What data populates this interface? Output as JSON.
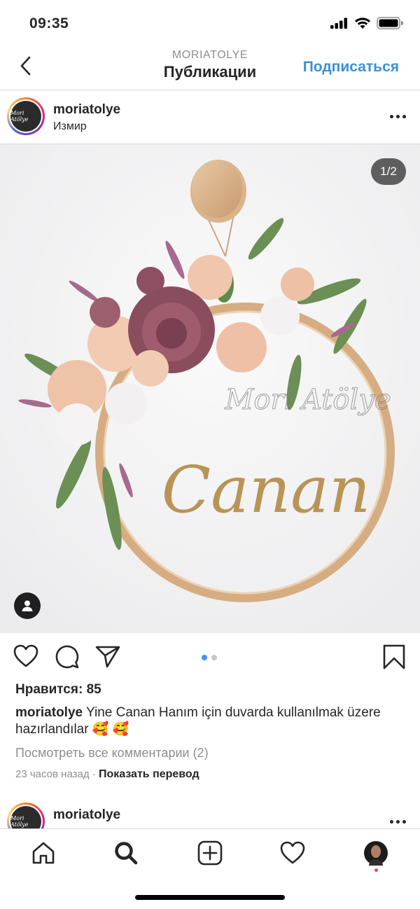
{
  "status_bar": {
    "time": "09:35"
  },
  "nav": {
    "subtitle": "MORIATOLYE",
    "title": "Публикации",
    "follow_label": "Подписаться"
  },
  "post": {
    "avatar_text": "Mori Atölye",
    "username": "moriatolye",
    "location": "Измир",
    "image_counter": "1/2",
    "image_text": {
      "name": "Canan",
      "watermark": "Mori Atölye"
    },
    "likes": "Нравится: 85",
    "caption_user": "moriatolye",
    "caption_text": "Yine Canan Hanım için duvarda kullanılmak üzere hazırlandılar 🥰 🥰",
    "view_comments": "Посмотреть все комментарии (2)",
    "time_ago": "23 часов назад",
    "separator": "·",
    "translate_label": "Показать перевод",
    "carousel": {
      "count": 2,
      "active": 1
    }
  },
  "next_post": {
    "avatar_text": "Mori Atölye",
    "username": "moriatolye"
  },
  "tabbar": {
    "items": [
      "home-icon",
      "search-icon",
      "new-post-icon",
      "activity-heart-icon",
      "profile-avatar"
    ],
    "active": "search-icon"
  },
  "colors": {
    "accent": "#3d8fd6",
    "carousel_active": "#3897f0",
    "notification": "#ed4956"
  }
}
